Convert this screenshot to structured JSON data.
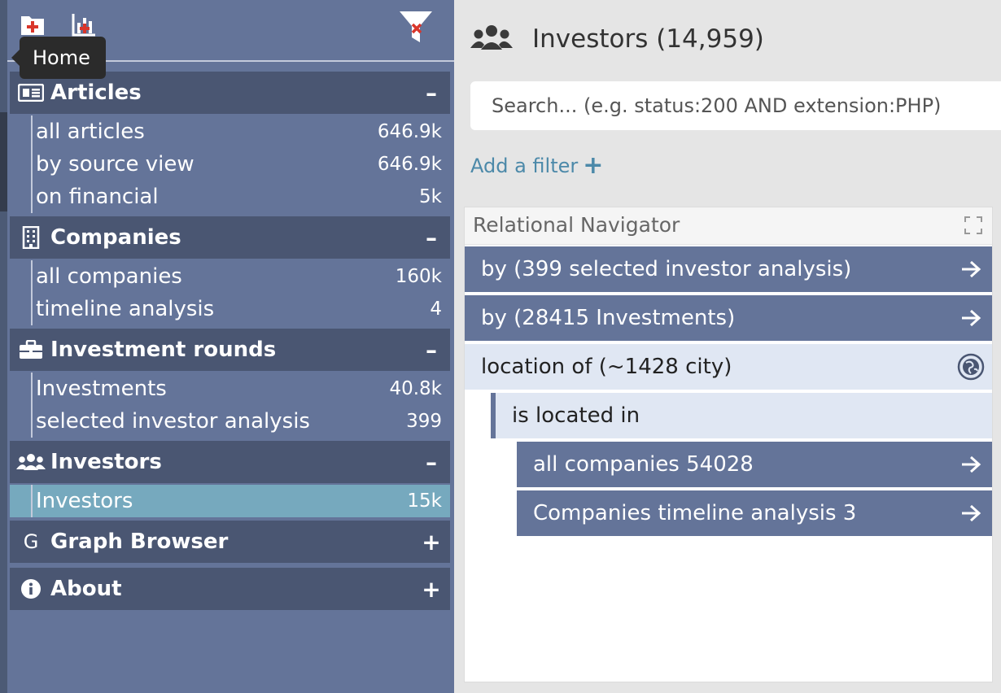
{
  "toolbar": {
    "tooltip": "Home",
    "icons": [
      "add-dashboard-icon",
      "add-chart-icon",
      "clear-filter-icon"
    ]
  },
  "sidebar": {
    "sections": [
      {
        "title": "Articles",
        "icon": "newspaper-icon",
        "toggle": "–",
        "items": [
          {
            "label": "all articles",
            "count": "646.9k"
          },
          {
            "label": "by source view",
            "count": "646.9k"
          },
          {
            "label": "on financial",
            "count": "5k"
          }
        ]
      },
      {
        "title": "Companies",
        "icon": "building-icon",
        "toggle": "–",
        "items": [
          {
            "label": "all companies",
            "count": "160k"
          },
          {
            "label": "timeline analysis",
            "count": "4"
          }
        ]
      },
      {
        "title": "Investment rounds",
        "icon": "briefcase-icon",
        "toggle": "–",
        "items": [
          {
            "label": "Investments",
            "count": "40.8k"
          },
          {
            "label": "selected investor analysis",
            "count": "399"
          }
        ]
      },
      {
        "title": "Investors",
        "icon": "users-icon",
        "toggle": "–",
        "items": [
          {
            "label": "Investors",
            "count": "15k",
            "active": true
          }
        ]
      },
      {
        "title": "Graph Browser",
        "icon": "G",
        "toggle": "+",
        "items": []
      },
      {
        "title": "About",
        "icon": "info-icon",
        "toggle": "+",
        "items": []
      }
    ]
  },
  "main": {
    "title": "Investors (14,959)",
    "search_placeholder": "Search... (e.g. status:200 AND extension:PHP)",
    "add_filter": "Add a filter",
    "panel": {
      "title": "Relational Navigator",
      "rows": [
        {
          "label": "by (399 selected investor analysis)",
          "style": "dark"
        },
        {
          "label": "by (28415 Investments)",
          "style": "dark"
        },
        {
          "label": "location of (~1428 city)",
          "style": "light"
        },
        {
          "label": "is located in",
          "style": "light"
        },
        {
          "label": "all companies 54028",
          "style": "dark"
        },
        {
          "label": "Companies timeline analysis 3",
          "style": "dark"
        }
      ]
    }
  },
  "colors": {
    "sidebar_bg": "#647499",
    "section_header": "#4a5672",
    "active_item": "#76a9be",
    "link": "#4c89a9",
    "nav_light": "#e0e7f3"
  }
}
